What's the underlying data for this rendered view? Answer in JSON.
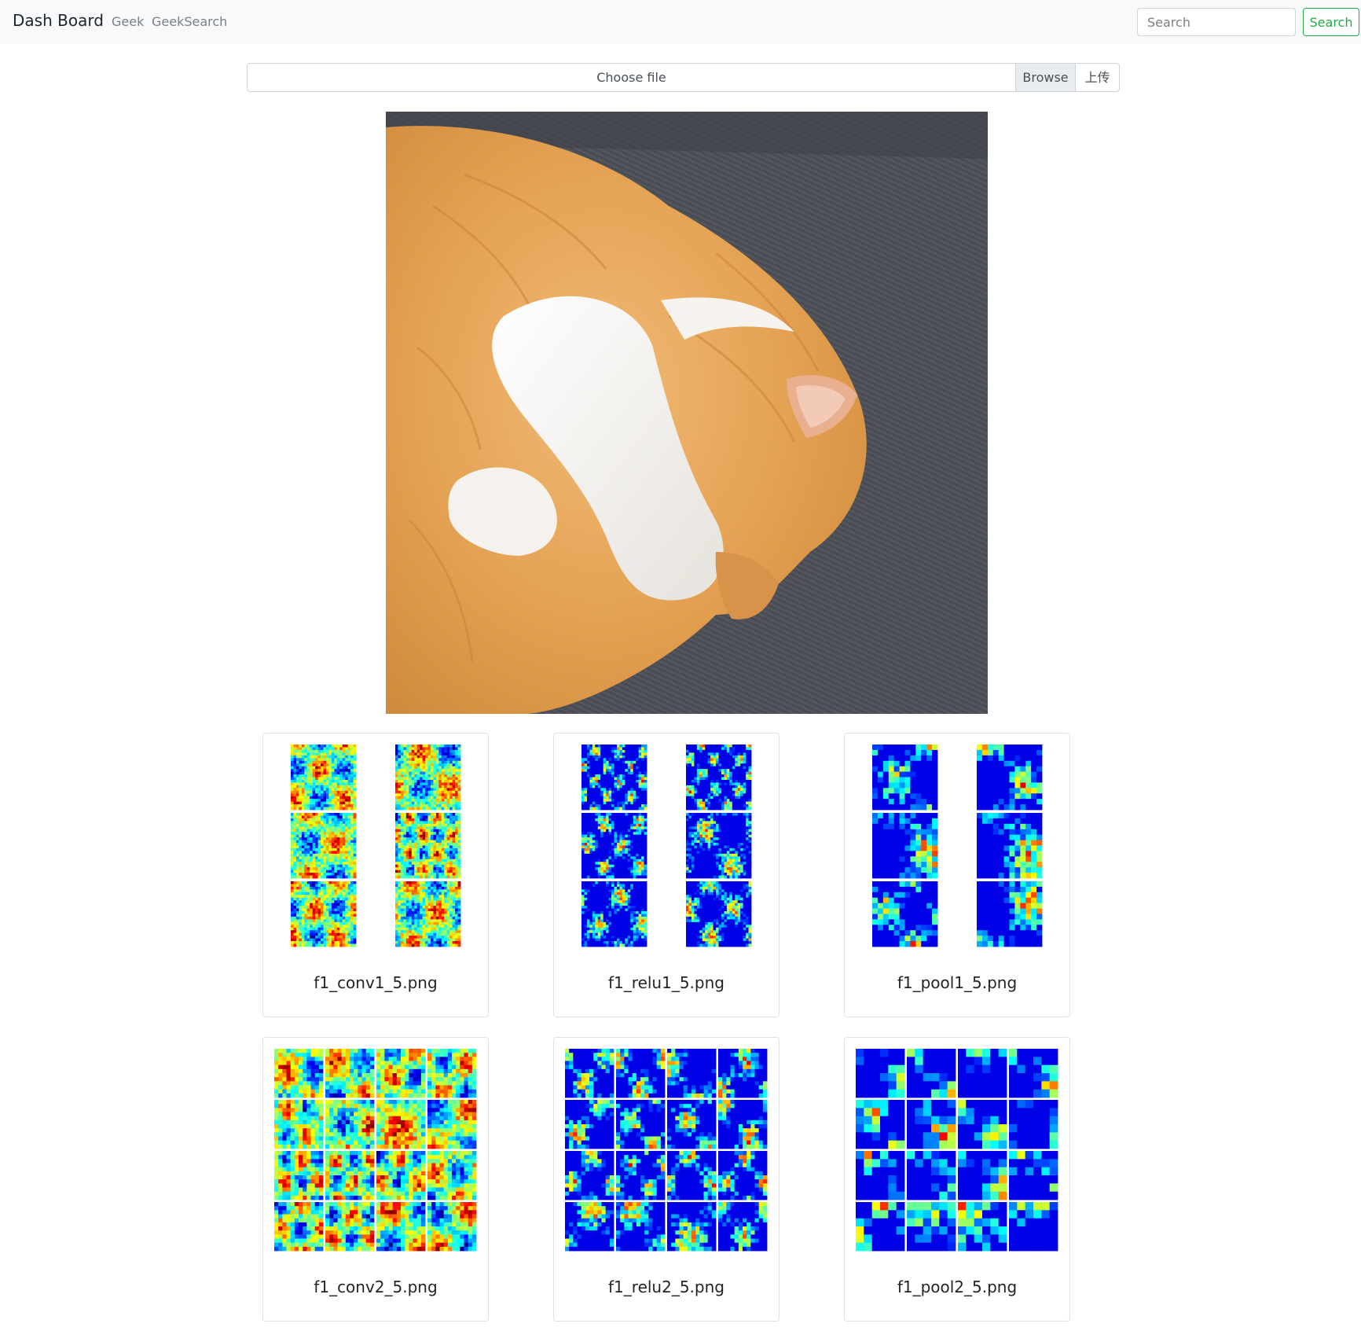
{
  "navbar": {
    "brand": "Dash Board",
    "links": [
      "Geek",
      "GeekSearch"
    ],
    "search_placeholder": "Search",
    "search_button": "Search"
  },
  "upload": {
    "choose_file": "Choose file",
    "browse": "Browse",
    "upload_button": "上传"
  },
  "results": [
    {
      "filename": "f1_conv1_5.png"
    },
    {
      "filename": "f1_relu1_5.png"
    },
    {
      "filename": "f1_pool1_5.png"
    },
    {
      "filename": "f1_conv2_5.png"
    },
    {
      "filename": "f1_relu2_5.png"
    },
    {
      "filename": "f1_pool2_5.png"
    }
  ],
  "colors": {
    "navbar_bg": "#f8f9fa",
    "success": "#28a745",
    "couch": "#4e5058",
    "fur_orange": "#e8a85a",
    "fur_white": "#f4f2ee"
  }
}
